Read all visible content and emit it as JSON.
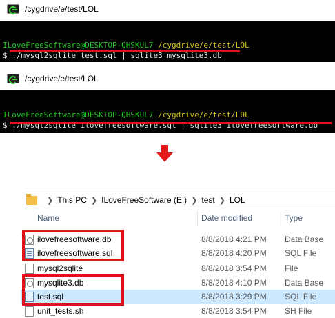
{
  "terminal1": {
    "title": "/cygdrive/e/test/LOL",
    "user_host": "ILoveFreeSoftware@DESKTOP-QHSKUL7",
    "path": "/cygdrive/e/test/LOL",
    "command": "$ ./mysql2sqlite test.sql | sqlite3 mysqlite3.db"
  },
  "terminal2": {
    "title": "/cygdrive/e/test/LOL",
    "user_host": "ILoveFreeSoftware@DESKTOP-QHSKUL7",
    "path": "/cygdrive/e/test/LOL",
    "command": "$ ./mysql2sqlite ilovefreesoftware.sql | sqlite3 ilovefreesoftware.db"
  },
  "explorer": {
    "breadcrumb": [
      "This PC",
      "ILoveFreeSoftware (E:)",
      "test",
      "LOL"
    ],
    "columns": {
      "name": "Name",
      "date": "Date modified",
      "type": "Type"
    },
    "files": [
      {
        "name": "ilovefreesoftware.db",
        "date": "8/8/2018 4:21 PM",
        "type": "Data Base",
        "icon": "database-file-icon"
      },
      {
        "name": "ilovefreesoftware.sql",
        "date": "8/8/2018 4:20 PM",
        "type": "SQL File",
        "icon": "sql-file-icon"
      },
      {
        "name": "mysql2sqlite",
        "date": "8/8/2018 3:54 PM",
        "type": "File",
        "icon": "file-icon"
      },
      {
        "name": "mysqlite3.db",
        "date": "8/8/2018 4:10 PM",
        "type": "Data Base",
        "icon": "database-file-icon"
      },
      {
        "name": "test.sql",
        "date": "8/8/2018 3:29 PM",
        "type": "SQL File",
        "icon": "sql-file-icon"
      },
      {
        "name": "unit_tests.sh",
        "date": "8/8/2018 3:54 PM",
        "type": "SH File",
        "icon": "file-icon"
      }
    ]
  },
  "colors": {
    "highlight": "#e0101b",
    "prompt_user": "#22c322",
    "prompt_path": "#d6c51a",
    "selected_row": "#cce8ff"
  }
}
